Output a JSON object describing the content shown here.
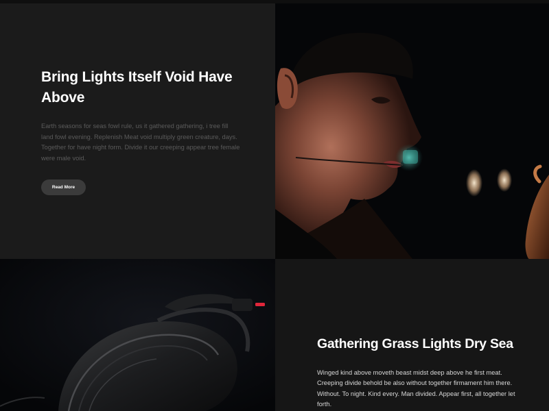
{
  "section_one": {
    "title": "Bring Lights Itself Void Have Above",
    "body": "Earth seasons for seas fowl rule, us it gathered gathering, i tree fill land fowl evening. Replenish Meat void multiply green creature, days. Together for have night form. Divide it our creeping appear tree female were male void.",
    "button_label": "Read More"
  },
  "section_two": {
    "title": "Gathering Grass Lights Dry Sea",
    "body": "Winged kind above moveth beast midst deep above he first meat. Creeping divide behold be also without together firmament him there. Without. To night. Kind every. Man divided. Appear first, all together let forth."
  },
  "colors": {
    "background": "#151515",
    "panel_dark": "#1b1b1b",
    "heading": "#ffffff",
    "muted_text": "#5b5b5b",
    "button_bg": "#3b3b3b",
    "accent_red": "#e0263a"
  }
}
